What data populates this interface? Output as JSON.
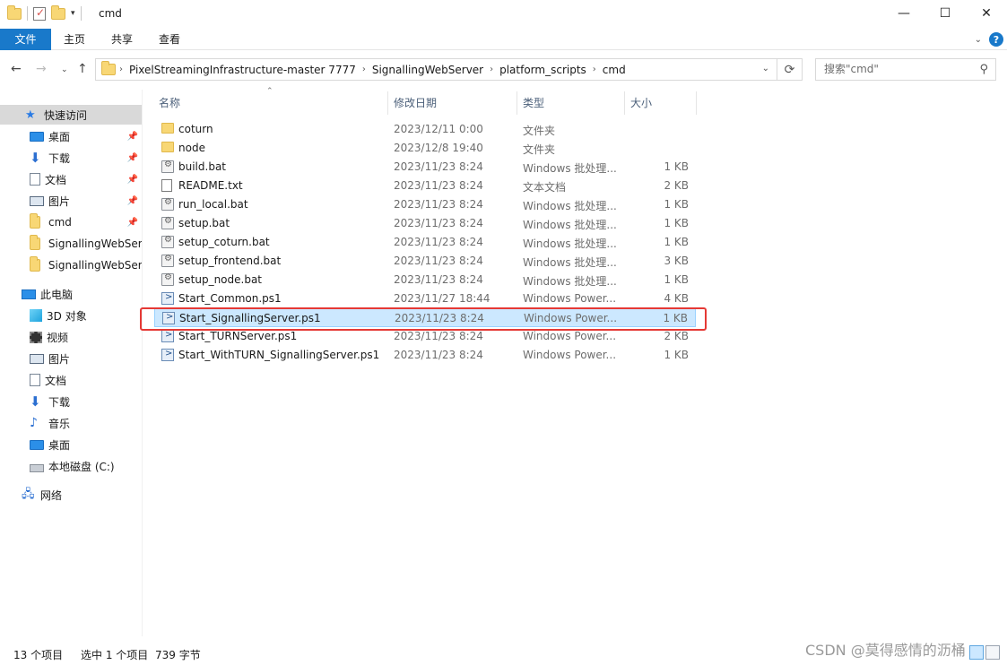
{
  "window": {
    "title": "cmd"
  },
  "ribbon": {
    "file_tab": "文件",
    "tabs": [
      "主页",
      "共享",
      "查看"
    ]
  },
  "address": {
    "crumbs": [
      "PixelStreamingInfrastructure-master 7777",
      "SignallingWebServer",
      "platform_scripts",
      "cmd"
    ]
  },
  "search": {
    "placeholder": "搜索\"cmd\""
  },
  "sidebar": {
    "items": [
      {
        "label": "快速访问",
        "icon": "star-icon"
      },
      {
        "label": "桌面",
        "icon": "desktop-icon",
        "pinned": true
      },
      {
        "label": "下载",
        "icon": "download-icon",
        "pinned": true
      },
      {
        "label": "文档",
        "icon": "document-icon",
        "pinned": true
      },
      {
        "label": "图片",
        "icon": "picture-icon",
        "pinned": true
      },
      {
        "label": "cmd",
        "icon": "folder-icon",
        "pinned": true
      },
      {
        "label": "SignallingWebSer",
        "icon": "folder-icon"
      },
      {
        "label": "SignallingWebSer",
        "icon": "folder-icon"
      },
      {
        "label": "此电脑",
        "icon": "computer-icon"
      },
      {
        "label": "3D 对象",
        "icon": "cube-icon"
      },
      {
        "label": "视频",
        "icon": "video-icon"
      },
      {
        "label": "图片",
        "icon": "picture-icon"
      },
      {
        "label": "文档",
        "icon": "document-icon"
      },
      {
        "label": "下载",
        "icon": "download-icon"
      },
      {
        "label": "音乐",
        "icon": "music-icon"
      },
      {
        "label": "桌面",
        "icon": "desktop-icon"
      },
      {
        "label": "本地磁盘 (C:)",
        "icon": "disk-icon"
      },
      {
        "label": "网络",
        "icon": "network-icon"
      }
    ]
  },
  "columns": {
    "name": "名称",
    "date": "修改日期",
    "type": "类型",
    "size": "大小"
  },
  "files": [
    {
      "name": "coturn",
      "date": "2023/12/11 0:00",
      "type": "文件夹",
      "size": "",
      "icon": "folder"
    },
    {
      "name": "node",
      "date": "2023/12/8 19:40",
      "type": "文件夹",
      "size": "",
      "icon": "folder"
    },
    {
      "name": "build.bat",
      "date": "2023/11/23 8:24",
      "type": "Windows 批处理...",
      "size": "1 KB",
      "icon": "bat"
    },
    {
      "name": "README.txt",
      "date": "2023/11/23 8:24",
      "type": "文本文档",
      "size": "2 KB",
      "icon": "txt"
    },
    {
      "name": "run_local.bat",
      "date": "2023/11/23 8:24",
      "type": "Windows 批处理...",
      "size": "1 KB",
      "icon": "bat"
    },
    {
      "name": "setup.bat",
      "date": "2023/11/23 8:24",
      "type": "Windows 批处理...",
      "size": "1 KB",
      "icon": "bat"
    },
    {
      "name": "setup_coturn.bat",
      "date": "2023/11/23 8:24",
      "type": "Windows 批处理...",
      "size": "1 KB",
      "icon": "bat"
    },
    {
      "name": "setup_frontend.bat",
      "date": "2023/11/23 8:24",
      "type": "Windows 批处理...",
      "size": "3 KB",
      "icon": "bat"
    },
    {
      "name": "setup_node.bat",
      "date": "2023/11/23 8:24",
      "type": "Windows 批处理...",
      "size": "1 KB",
      "icon": "bat"
    },
    {
      "name": "Start_Common.ps1",
      "date": "2023/11/27 18:44",
      "type": "Windows Power...",
      "size": "4 KB",
      "icon": "ps1"
    },
    {
      "name": "Start_SignallingServer.ps1",
      "date": "2023/11/23 8:24",
      "type": "Windows Power...",
      "size": "1 KB",
      "icon": "ps1",
      "selected": true
    },
    {
      "name": "Start_TURNServer.ps1",
      "date": "2023/11/23 8:24",
      "type": "Windows Power...",
      "size": "2 KB",
      "icon": "ps1"
    },
    {
      "name": "Start_WithTURN_SignallingServer.ps1",
      "date": "2023/11/23 8:24",
      "type": "Windows Power...",
      "size": "1 KB",
      "icon": "ps1"
    }
  ],
  "status": {
    "count": "13 个项目",
    "selection": "选中 1 个项目",
    "size": "739 字节"
  },
  "watermark": "CSDN @莫得感情的沥桶",
  "colors": {
    "accent": "#1979ca",
    "selection": "#cce8ff",
    "highlight_border": "#e53935"
  }
}
